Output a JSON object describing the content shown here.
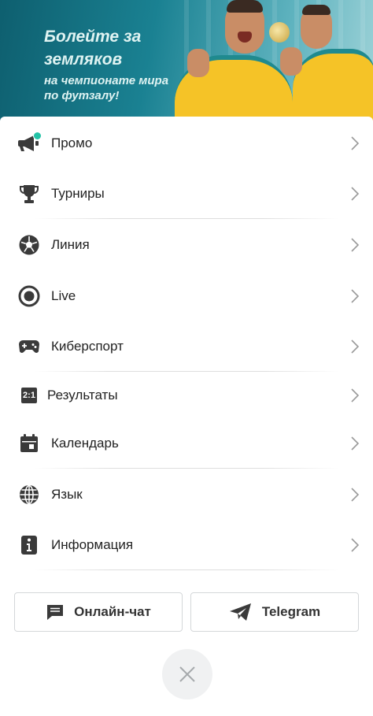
{
  "banner": {
    "title": "Болейте за земляков",
    "subtitle": "на чемпионате мира по футзалу!"
  },
  "menu": {
    "items": [
      {
        "label": "Промо",
        "icon": "megaphone-icon",
        "badge": "new-dot"
      },
      {
        "label": "Турниры",
        "icon": "trophy-icon"
      },
      {
        "label": "Линия",
        "icon": "soccer-ball-icon"
      },
      {
        "label": "Live",
        "icon": "live-circle-icon"
      },
      {
        "label": "Киберспорт",
        "icon": "gamepad-icon"
      },
      {
        "label": "Результаты",
        "icon": "score-icon",
        "icon_text": "2:1"
      },
      {
        "label": "Календарь",
        "icon": "calendar-icon"
      },
      {
        "label": "Язык",
        "icon": "globe-icon"
      },
      {
        "label": "Информация",
        "icon": "info-icon"
      }
    ]
  },
  "buttons": {
    "chat_label": "Онлайн-чат",
    "chat_icon": "chat-bubble-icon",
    "telegram_label": "Telegram",
    "telegram_icon": "telegram-icon",
    "close_icon": "close-icon"
  },
  "colors": {
    "accent_dot": "#24c3a7",
    "icon": "#3a3a3a",
    "chevron": "#9a9a9a",
    "banner": "#1a8192"
  }
}
